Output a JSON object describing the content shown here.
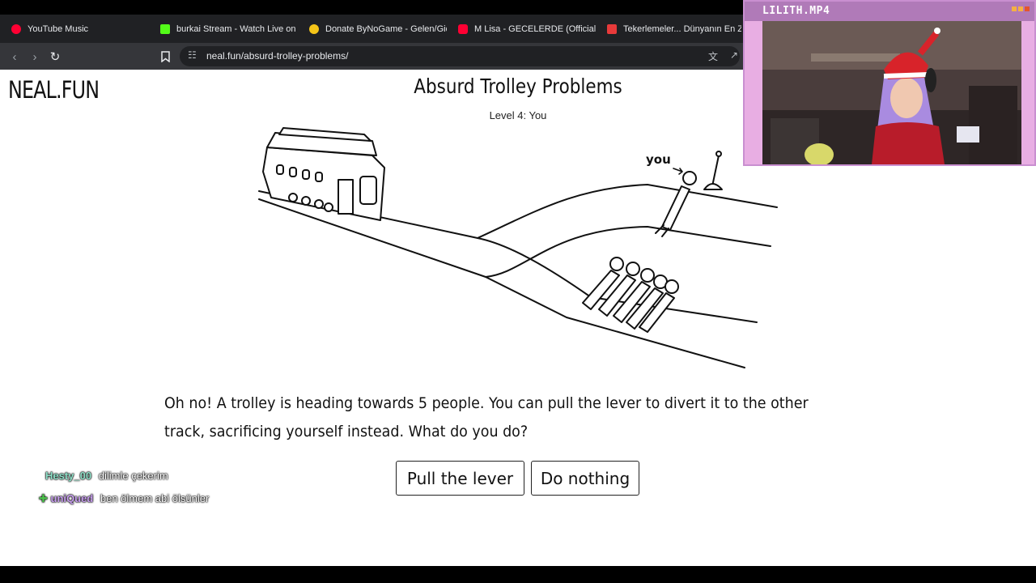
{
  "browser": {
    "tabs": [
      {
        "label": "YouTube Music",
        "favicon_color": "#ff0033"
      },
      {
        "label": "burkai Stream - Watch Live on K",
        "favicon_color": "#53fc18"
      },
      {
        "label": "Donate ByNoGame - Gelen/Gid",
        "favicon_color": "#f5c518"
      },
      {
        "label": "M Lisa - GECELERDE (Official Ly",
        "favicon_color": "#ff0033"
      },
      {
        "label": "Tekerlemeler... Dünyanın En Zor",
        "favicon_color": "#e83a3a"
      }
    ],
    "url": "neal.fun/absurd-trolley-problems/"
  },
  "page": {
    "logo": "NEAL.FUN",
    "title": "Absurd Trolley Problems",
    "level": "Level 4: You",
    "scene_label_you": "you",
    "question": "Oh no! A trolley is heading towards 5 people. You can pull the lever to divert it to the other track, sacrificing yourself instead. What do you do?",
    "buttons": {
      "pull": "Pull the lever",
      "nothing": "Do nothing"
    }
  },
  "chat": [
    {
      "user": "Hesty_00",
      "user_color": "#8fe0c8",
      "message": "dilimle çekerim"
    },
    {
      "user": "uniQued",
      "user_color": "#c9a0f0",
      "message": "ben ölmem abi ölsünler"
    }
  ],
  "webcam": {
    "title": "LILITH.MP4"
  }
}
